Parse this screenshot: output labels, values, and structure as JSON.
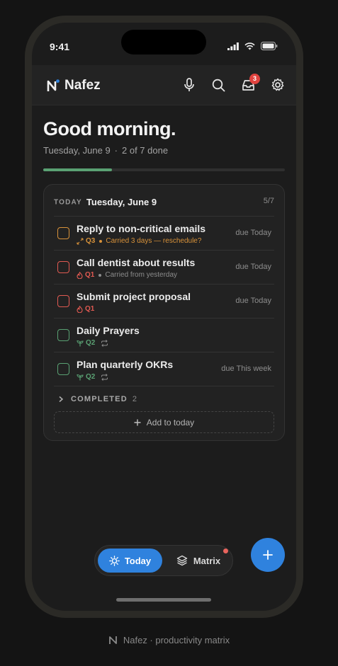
{
  "status_bar": {
    "time": "9:41"
  },
  "app": {
    "name": "Nafez",
    "notification_count": "3",
    "icons": [
      "microphone-icon",
      "search-icon",
      "inbox-icon",
      "gear-icon"
    ]
  },
  "header": {
    "greeting": "Good morning.",
    "date": "Tuesday, June 9",
    "done_text": "2 of 7 done",
    "progress": 0.2857
  },
  "card": {
    "today_label": "TODAY",
    "date": "Tuesday, June 9",
    "count": "5/7",
    "tasks": [
      {
        "title": "Reply to non-critical emails",
        "quadrant": "Q3",
        "quad_color": "#d8923a",
        "note": "Carried 3 days — reschedule?",
        "note_color": "#d8923a",
        "due": "due Today",
        "repeat": false,
        "icon": "delegate-arrows-icon"
      },
      {
        "title": "Call dentist about results",
        "quadrant": "Q1",
        "quad_color": "#e15a52",
        "note": "Carried from yesterday",
        "note_color": "#8d8d8d",
        "due": "due Today",
        "repeat": false,
        "icon": "fire-icon"
      },
      {
        "title": "Submit project proposal",
        "quadrant": "Q1",
        "quad_color": "#e15a52",
        "note": "",
        "note_color": "#8d8d8d",
        "due": "due Today",
        "repeat": false,
        "icon": "fire-icon"
      },
      {
        "title": "Daily Prayers",
        "quadrant": "Q2",
        "quad_color": "#5aa173",
        "note": "",
        "note_color": "#8d8d8d",
        "due": "",
        "repeat": true,
        "icon": "sprout-icon"
      },
      {
        "title": "Plan quarterly OKRs",
        "quadrant": "Q2",
        "quad_color": "#5aa173",
        "note": "",
        "note_color": "#8d8d8d",
        "due": "due This week",
        "repeat": true,
        "icon": "sprout-icon"
      }
    ],
    "completed_label": "COMPLETED",
    "completed_count": "2",
    "add_label": "Add to today"
  },
  "tabs": {
    "today": "Today",
    "matrix": "Matrix"
  },
  "footer": {
    "text": "Nafez · productivity matrix"
  },
  "colors": {
    "accent": "#2f82de",
    "progress": "#5aa173",
    "background": "#1c1c1c",
    "badge": "#e0433f"
  }
}
